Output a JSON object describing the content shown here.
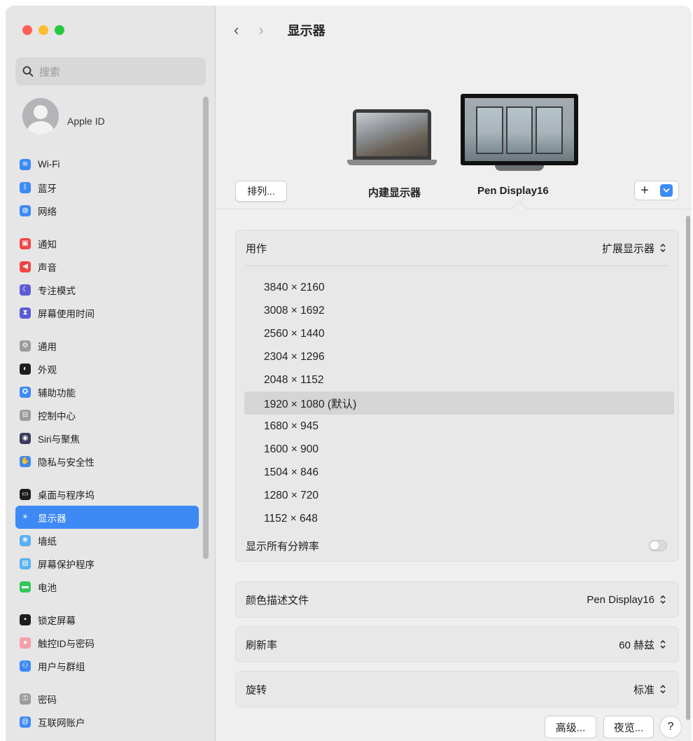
{
  "window": {
    "controls": {
      "close_color": "#ff5f57",
      "minimize_color": "#febc2e",
      "zoom_color": "#28c840"
    }
  },
  "sidebar": {
    "search_placeholder": "搜索",
    "apple_id_label": "Apple ID",
    "groups": [
      [
        {
          "label": "Wi-Fi",
          "icon": "wifi-icon",
          "color": "#3d8af5",
          "glyph": "≋"
        },
        {
          "label": "蓝牙",
          "icon": "bluetooth-icon",
          "color": "#3d8af5",
          "glyph": "ᛒ"
        },
        {
          "label": "网络",
          "icon": "globe-icon",
          "color": "#3d8af5",
          "glyph": "◍"
        }
      ],
      [
        {
          "label": "通知",
          "icon": "notification-icon",
          "color": "#f04545",
          "glyph": "▣"
        },
        {
          "label": "声音",
          "icon": "speaker-icon",
          "color": "#f04545",
          "glyph": "◀"
        },
        {
          "label": "专注模式",
          "icon": "moon-icon",
          "color": "#5b5bd6",
          "glyph": "☾"
        },
        {
          "label": "屏幕使用时间",
          "icon": "hourglass-icon",
          "color": "#5b5bd6",
          "glyph": "⧗"
        }
      ],
      [
        {
          "label": "通用",
          "icon": "gear-icon",
          "color": "#9c9c9c",
          "glyph": "⚙"
        },
        {
          "label": "外观",
          "icon": "appearance-icon",
          "color": "#1d1d1f",
          "glyph": "◐"
        },
        {
          "label": "辅助功能",
          "icon": "accessibility-icon",
          "color": "#3d8af5",
          "glyph": "✪"
        },
        {
          "label": "控制中心",
          "icon": "control-center-icon",
          "color": "#9c9c9c",
          "glyph": "⊟"
        },
        {
          "label": "Siri与聚焦",
          "icon": "siri-icon",
          "color": "#3a3a5c",
          "glyph": "◉"
        },
        {
          "label": "隐私与安全性",
          "icon": "hand-icon",
          "color": "#3d8af5",
          "glyph": "✋"
        }
      ],
      [
        {
          "label": "桌面与程序坞",
          "icon": "dock-icon",
          "color": "#1d1d1f",
          "glyph": "▭"
        },
        {
          "label": "显示器",
          "icon": "display-icon",
          "color": "#3d8af5",
          "glyph": "☀",
          "active": true
        },
        {
          "label": "墙纸",
          "icon": "wallpaper-icon",
          "color": "#5ab0f0",
          "glyph": "❋"
        },
        {
          "label": "屏幕保护程序",
          "icon": "screensaver-icon",
          "color": "#5ab0f0",
          "glyph": "▤"
        },
        {
          "label": "电池",
          "icon": "battery-icon",
          "color": "#34c759",
          "glyph": "▬"
        }
      ],
      [
        {
          "label": "锁定屏幕",
          "icon": "lock-screen-icon",
          "color": "#1d1d1f",
          "glyph": "▪"
        },
        {
          "label": "触控ID与密码",
          "icon": "fingerprint-icon",
          "color": "#f5a0a8",
          "glyph": "●"
        },
        {
          "label": "用户与群组",
          "icon": "users-icon",
          "color": "#3d8af5",
          "glyph": "⚇"
        }
      ],
      [
        {
          "label": "密码",
          "icon": "key-icon",
          "color": "#9c9c9c",
          "glyph": "⚿"
        },
        {
          "label": "互联网账户",
          "icon": "at-icon",
          "color": "#3d8af5",
          "glyph": "@"
        }
      ]
    ]
  },
  "header": {
    "back_glyph": "‹",
    "forward_glyph": "›",
    "title": "显示器"
  },
  "displays": {
    "arrange_label": "排列...",
    "builtin_label": "内建显示器",
    "external_label": "Pen Display16",
    "plus_glyph": "+"
  },
  "settings": {
    "use_as_label": "用作",
    "use_as_value": "扩展显示器",
    "resolutions": [
      "3840 × 2160",
      "3008 × 1692",
      "2560 × 1440",
      "2304 × 1296",
      "2048 × 1152",
      "1920 × 1080 (默认)",
      "1680 × 945",
      "1600 × 900",
      "1504 × 846",
      "1280 × 720",
      "1152 × 648"
    ],
    "selected_resolution_index": 5,
    "show_all_label": "显示所有分辨率",
    "show_all_on": false,
    "color_profile_label": "颜色描述文件",
    "color_profile_value": "Pen Display16",
    "refresh_label": "刷新率",
    "refresh_value": "60 赫兹",
    "rotation_label": "旋转",
    "rotation_value": "标准"
  },
  "footer": {
    "advanced_label": "高级...",
    "night_shift_label": "夜览...",
    "help_glyph": "?"
  },
  "colors": {
    "accent": "#3d8af5"
  }
}
